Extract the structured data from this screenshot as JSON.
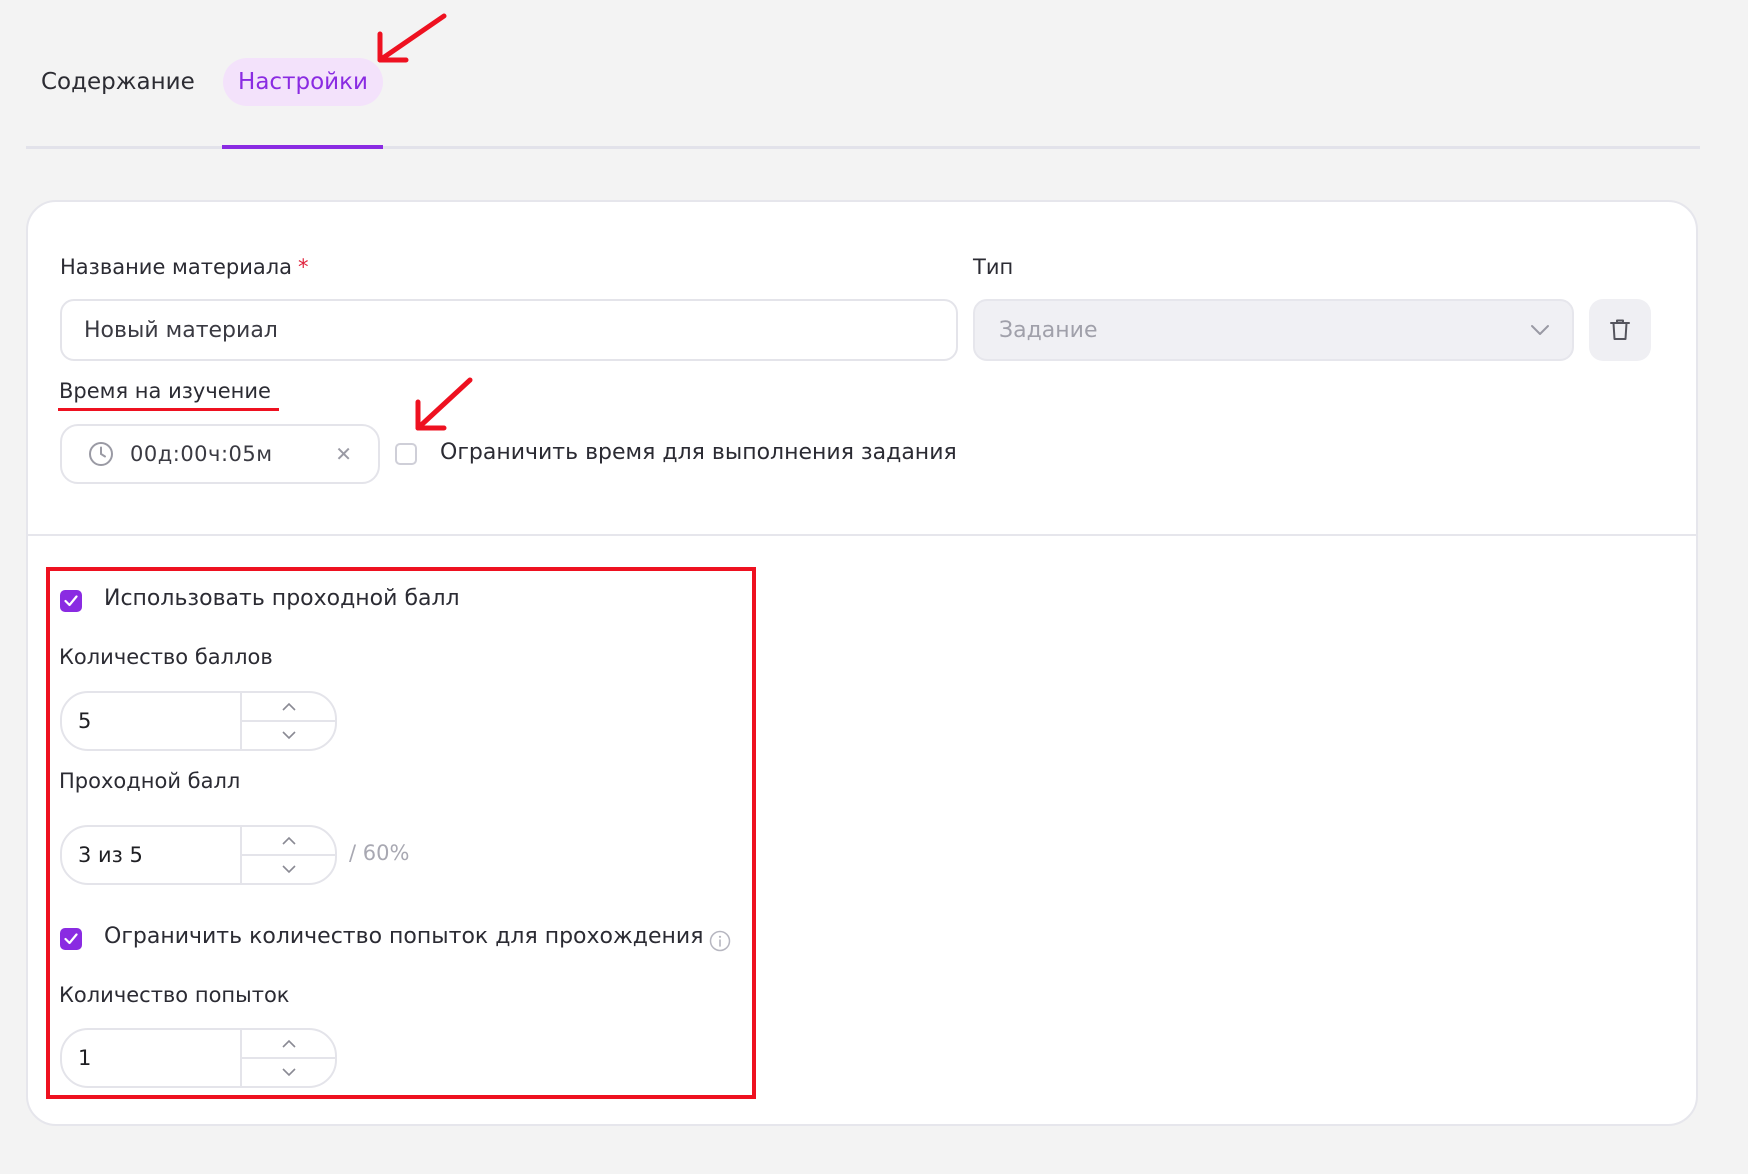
{
  "tabs": [
    {
      "label": "Содержание",
      "active": false
    },
    {
      "label": "Настройки",
      "active": true
    }
  ],
  "form": {
    "name_label": "Название материала",
    "required_mark": "*",
    "name_value": "Новый материал",
    "type_label": "Тип",
    "type_value": "Задание",
    "study_time_label": "Время на изучение",
    "study_time_value": "00д:00ч:05м",
    "limit_time_label": "Ограничить время для выполнения задания",
    "limit_time_checked": false
  },
  "scoring": {
    "use_passing_label": "Использовать проходной балл",
    "use_passing_checked": true,
    "points_label": "Количество баллов",
    "points_value": "5",
    "passing_label": "Проходной балл",
    "passing_value": "3 из 5",
    "passing_percent": "/ 60%",
    "limit_attempts_label": "Ограничить количество попыток для прохождения",
    "limit_attempts_checked": true,
    "attempts_label": "Количество попыток",
    "attempts_value": "1"
  },
  "icons": {
    "clock": "clock-icon",
    "clear": "close-icon",
    "chevron": "chevron-down-icon",
    "delete": "trash-icon",
    "info": "info-icon"
  },
  "colors": {
    "accent": "#8a2be2",
    "accent_bg": "#f3e2fb",
    "annotation": "#ee1120"
  }
}
